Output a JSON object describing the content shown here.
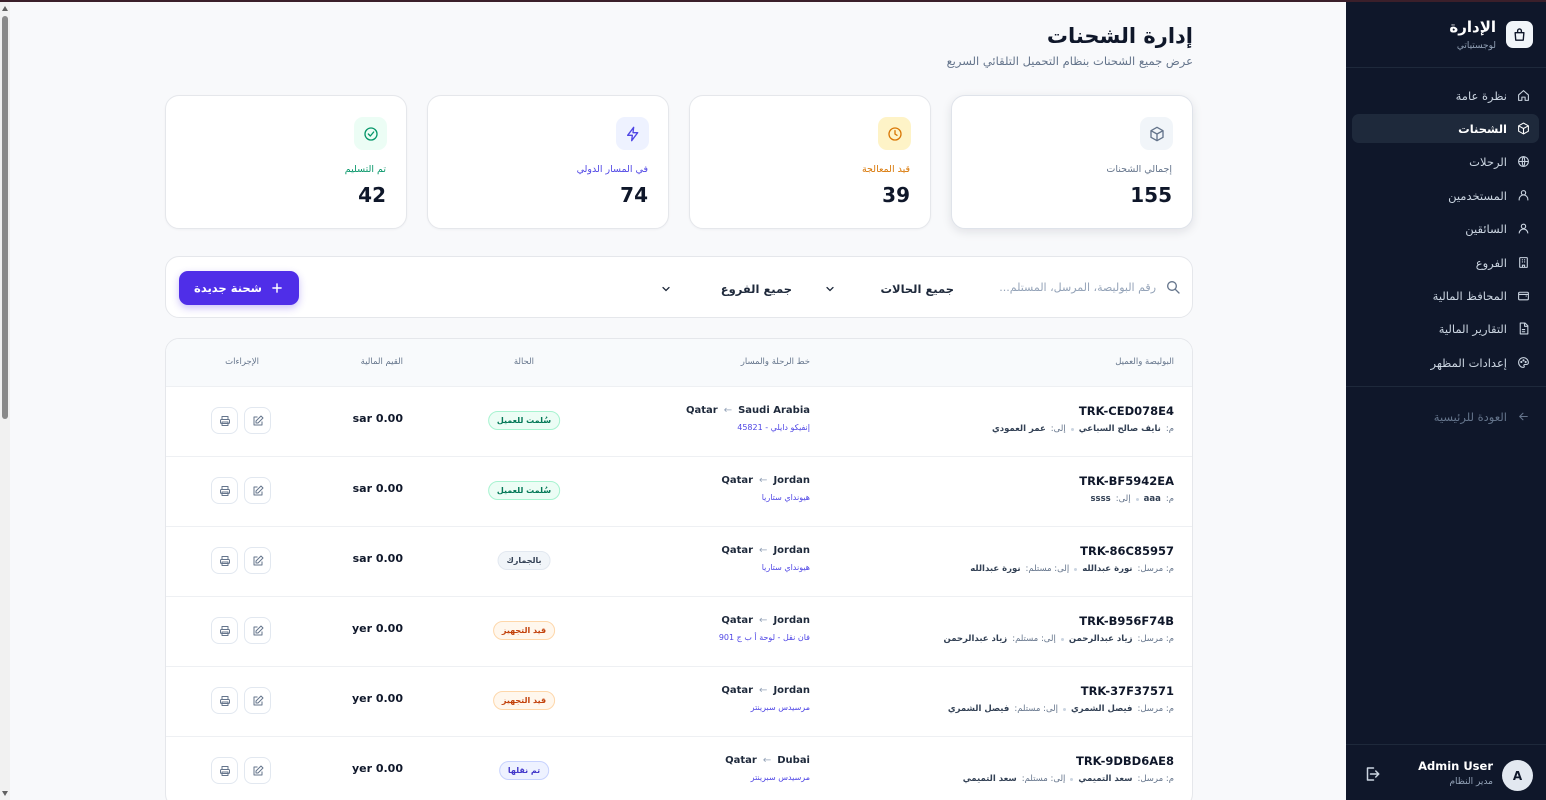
{
  "header": {
    "title": "إدارة الشحنات",
    "subtitle": "عرض جميع الشحنات بنظام التحميل التلقائي السريع"
  },
  "stats": [
    {
      "label": "إجمالي الشحنات",
      "value": "155",
      "icon": "box-icon",
      "color": "#64748b"
    },
    {
      "label": "قيد المعالجة",
      "value": "39",
      "icon": "clock-icon",
      "color": "#d97706"
    },
    {
      "label": "في المسار الدولي",
      "value": "74",
      "icon": "bolt-icon",
      "color": "#4f46e5"
    },
    {
      "label": "تم التسليم",
      "value": "42",
      "icon": "check-circle-icon",
      "color": "#059669"
    }
  ],
  "filters": {
    "search_placeholder": "رقم البوليصة، المرسل، المستلم...",
    "status_select": "جميع الحالات",
    "branch_select": "جميع الفروع",
    "new_button": "شحنة جديدة"
  },
  "table": {
    "headers": {
      "awb": "البوليصة والعميل",
      "route": "خط الرحلة والمسار",
      "status": "الحالة",
      "amount": "القيم المالية",
      "actions": "الإجراءات"
    },
    "rows": [
      {
        "awb": "TRK-CED078E4",
        "from_prefix": "م:",
        "sender": "نايف صالح السباعي",
        "to_prefix": "إلى:",
        "receiver": "عمر العمودي",
        "origin": "Saudi Arabia",
        "arrow": "←",
        "destination": "Qatar",
        "vehicle": "إنفيكو دايلي - 45821",
        "status": "سُلمت للعميل",
        "status_color": "green",
        "amount": "sar 0.00"
      },
      {
        "awb": "TRK-BF5942EA",
        "from_prefix": "م:",
        "sender": "aaa",
        "to_prefix": "إلى:",
        "receiver": "ssss",
        "origin": "Jordan",
        "arrow": "←",
        "destination": "Qatar",
        "vehicle": "هيونداي ستاريا",
        "status": "سُلمت للعميل",
        "status_color": "green",
        "amount": "sar 0.00"
      },
      {
        "awb": "TRK-86C85957",
        "from_prefix": "م: مرسل:",
        "sender": "نورة عبدالله",
        "to_prefix": "إلى: مستلم:",
        "receiver": "نورة عبدالله",
        "origin": "Jordan",
        "arrow": "←",
        "destination": "Qatar",
        "vehicle": "هيونداي ستاريا",
        "status": "بالجمارك",
        "status_color": "gray",
        "amount": "sar 0.00"
      },
      {
        "awb": "TRK-B956F74B",
        "from_prefix": "م: مرسل:",
        "sender": "زياد عبدالرحمن",
        "to_prefix": "إلى: مستلم:",
        "receiver": "زياد عبدالرحمن",
        "origin": "Jordan",
        "arrow": "←",
        "destination": "Qatar",
        "vehicle": "فان نقل - لوحة أ ب ج 901",
        "status": "قيد التجهيز",
        "status_color": "orange",
        "amount": "yer 0.00"
      },
      {
        "awb": "TRK-37F37571",
        "from_prefix": "م: مرسل:",
        "sender": "فيصل الشمري",
        "to_prefix": "إلى: مستلم:",
        "receiver": "فيصل الشمري",
        "origin": "Jordan",
        "arrow": "←",
        "destination": "Qatar",
        "vehicle": "مرسيدس سبرينتر",
        "status": "قيد التجهيز",
        "status_color": "orange",
        "amount": "yer 0.00"
      },
      {
        "awb": "TRK-9DBD6AE8",
        "from_prefix": "م: مرسل:",
        "sender": "سعد التميمي",
        "to_prefix": "إلى: مستلم:",
        "receiver": "سعد التميمي",
        "origin": "Dubai",
        "arrow": "←",
        "destination": "Qatar",
        "vehicle": "مرسيدس سبرينتر",
        "status": "تم نقلها",
        "status_color": "blue",
        "amount": "yer 0.00"
      }
    ]
  },
  "sidebar": {
    "brand_title": "الإدارة",
    "brand_subtitle": "لوجستياتي",
    "items": [
      {
        "label": "نظرة عامة",
        "icon": "home-icon"
      },
      {
        "label": "الشحنات",
        "icon": "box-icon",
        "active": true
      },
      {
        "label": "الرحلات",
        "icon": "globe-icon"
      },
      {
        "label": "المستخدمين",
        "icon": "users-icon"
      },
      {
        "label": "السائقين",
        "icon": "user-icon"
      },
      {
        "label": "الفروع",
        "icon": "building-icon"
      },
      {
        "label": "المحافظ المالية",
        "icon": "wallet-icon"
      },
      {
        "label": "التقارير المالية",
        "icon": "file-icon"
      },
      {
        "label": "إعدادات المظهر",
        "icon": "palette-icon"
      }
    ],
    "back_label": "العودة للرئيسية",
    "user_name": "Admin User",
    "user_role": "مدير النظام",
    "user_initial": "A"
  }
}
